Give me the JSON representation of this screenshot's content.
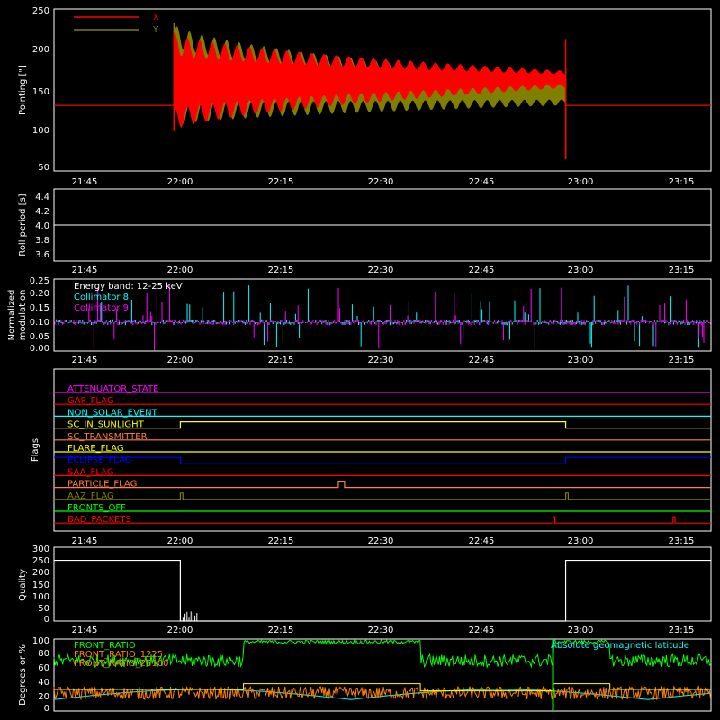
{
  "chart_data": [
    {
      "type": "line",
      "id": "pointing",
      "ylabel": "Pointing [\"]",
      "xlim": [
        "21:38",
        "23:22"
      ],
      "ylim": [
        45,
        250
      ],
      "yticks": [
        "50",
        "100",
        "150",
        "200",
        "250"
      ],
      "xticks": [
        "21:45",
        "22:00",
        "22:15",
        "22:30",
        "22:45",
        "23:00",
        "23:15"
      ],
      "legend_position": "top-left",
      "series": [
        {
          "name": "X",
          "color": "#ff0000",
          "baseline": 128,
          "start": "21:57",
          "end": "22:59",
          "envelope_start": [
            95,
            220
          ],
          "envelope_end": [
            150,
            172
          ]
        },
        {
          "name": "Y",
          "color": "#808000",
          "baseline": 128,
          "start": "21:57",
          "end": "22:59",
          "envelope_start": [
            102,
            232
          ],
          "envelope_end": [
            128,
            162
          ]
        }
      ]
    },
    {
      "type": "line",
      "id": "roll-period",
      "ylabel": "Roll period [s]",
      "xlim": [
        "21:38",
        "23:22"
      ],
      "ylim": [
        3.5,
        4.5
      ],
      "yticks": [
        "3.6",
        "3.8",
        "4.0",
        "4.2",
        "4.4"
      ],
      "xticks": [
        "21:45",
        "22:00",
        "22:15",
        "22:30",
        "22:45",
        "23:00",
        "23:15"
      ],
      "series": [
        {
          "color": "#ffffff",
          "value": 4.0
        }
      ]
    },
    {
      "type": "line",
      "id": "modulation",
      "ylabel": "Normalized modulation",
      "xlim": [
        "21:38",
        "23:22"
      ],
      "ylim": [
        0,
        0.25
      ],
      "yticks": [
        "0.00",
        "0.05",
        "0.10",
        "0.15",
        "0.20",
        "0.25"
      ],
      "xticks": [
        "21:45",
        "22:00",
        "22:15",
        "22:30",
        "22:45",
        "23:00",
        "23:15"
      ],
      "annotation": "Energy band: 12-25 keV",
      "series": [
        {
          "name": "Collimator 8",
          "color": "#00ffff",
          "baseline": 0.1
        },
        {
          "name": "Collimator 9",
          "color": "#ff00ff",
          "baseline": 0.1
        }
      ]
    },
    {
      "type": "line",
      "id": "flags",
      "ylabel": "Flags",
      "xlim": [
        "21:38",
        "23:22"
      ],
      "xticks": [
        "21:45",
        "22:00",
        "22:15",
        "22:30",
        "22:45",
        "23:00",
        "23:15"
      ],
      "series": [
        {
          "name": "ATTENUATOR_STATE",
          "color": "#ff00ff",
          "pulses": []
        },
        {
          "name": "GAP_FLAG",
          "color": "#ff0000",
          "pulses": []
        },
        {
          "name": "NON_SOLAR_EVENT",
          "color": "#00ffff",
          "pulses": []
        },
        {
          "name": "SC_IN_SUNLIGHT",
          "color": "#ffff00",
          "pulses": [
            [
              "21:58",
              "22:59"
            ]
          ]
        },
        {
          "name": "SC_TRANSMITTER",
          "color": "#ff8040",
          "pulses": []
        },
        {
          "name": "FLARE_FLAG",
          "color": "#ffff00",
          "pulses": []
        },
        {
          "name": "ECLIPSE_FLAG",
          "color": "#0000ff",
          "base_high": true,
          "dips": [
            [
              "21:58",
              "22:59"
            ]
          ]
        },
        {
          "name": "SAA_FLAG",
          "color": "#ff0000",
          "pulses": []
        },
        {
          "name": "PARTICLE_FLAG",
          "color": "#ff8040",
          "pulses": [
            [
              "22:23",
              "22:24"
            ]
          ]
        },
        {
          "name": "AAZ_FLAG",
          "color": "#808000",
          "pulses": [
            [
              "21:58",
              "21:58.4"
            ],
            [
              "22:59",
              "22:59.4"
            ]
          ]
        },
        {
          "name": "FRONTS_OFF",
          "color": "#00ff00",
          "pulses": []
        },
        {
          "name": "BAD_PACKETS",
          "color": "#ff0000",
          "pulses": [
            [
              "22:57",
              "22:57.3"
            ],
            [
              "23:16",
              "23:16.3"
            ]
          ]
        }
      ]
    },
    {
      "type": "line",
      "id": "quality",
      "ylabel": "Quality",
      "xlim": [
        "21:38",
        "23:22"
      ],
      "ylim": [
        0,
        310
      ],
      "yticks": [
        "0",
        "50",
        "100",
        "150",
        "200",
        "250",
        "300"
      ],
      "xticks": [
        "21:45",
        "22:00",
        "22:15",
        "22:30",
        "22:45",
        "23:00",
        "23:15"
      ],
      "series": [
        {
          "color": "#ffffff",
          "high_value": 255,
          "low_value": 0,
          "low_start": "21:58",
          "low_end": "22:59"
        }
      ]
    },
    {
      "type": "line",
      "id": "ratios",
      "ylabel": "Degrees or %",
      "xlim": [
        "21:38",
        "23:22"
      ],
      "ylim": [
        0,
        100
      ],
      "yticks": [
        "0",
        "20",
        "40",
        "60",
        "80",
        "100"
      ],
      "series": [
        {
          "name": "FRONT_RATIO",
          "color": "#00ff00",
          "baseline": 70
        },
        {
          "name": "FRONT_RATIO_1225",
          "color": "#ff8000",
          "baseline": 25
        },
        {
          "name": "FRONT_RATIO_25100",
          "color": "#ff8000"
        },
        {
          "name": "Absolute geomagnetic latitude",
          "color": "#00ffff"
        }
      ]
    }
  ]
}
